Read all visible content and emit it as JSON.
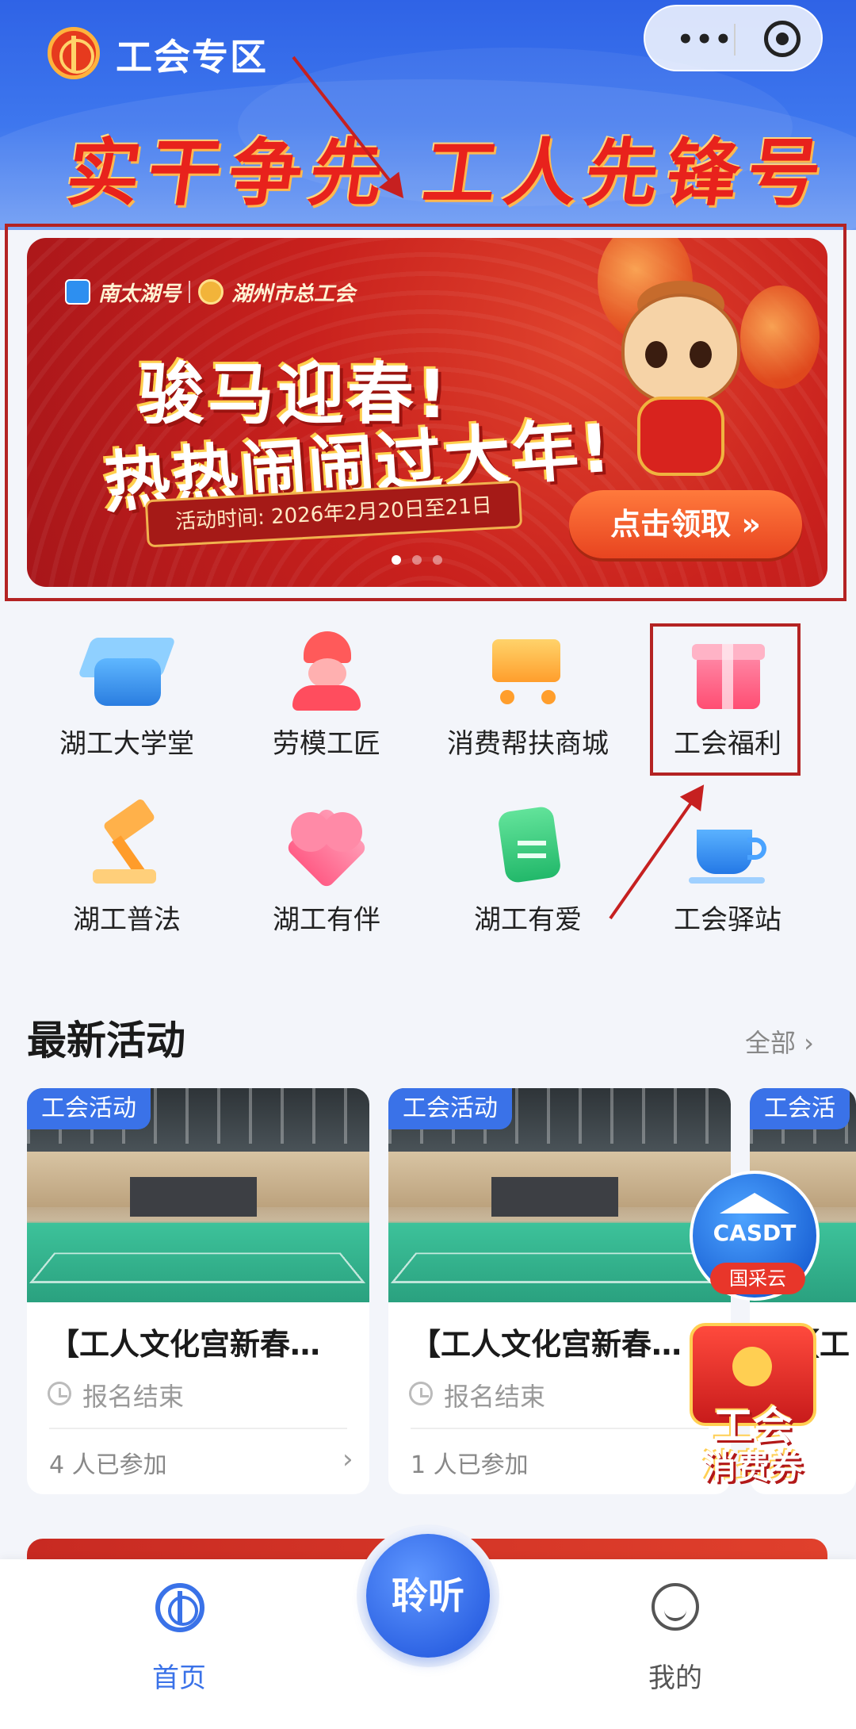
{
  "header": {
    "title": "工会专区",
    "slogan": "实干争先 工人先锋号",
    "capsule_more": "•••"
  },
  "banner": {
    "partner1": "南太湖号",
    "partner2": "湖州市总工会",
    "headline_line1": "骏马迎春!",
    "headline_line2": "热热闹闹过大年!",
    "date_text": "活动时间: 2026年2月20日至21日",
    "cta": "点击领取 »",
    "active_slide": 1,
    "slide_count": 3
  },
  "grid": [
    {
      "label": "湖工大学堂",
      "icon": "graduation-cap-icon"
    },
    {
      "label": "劳模工匠",
      "icon": "worker-icon"
    },
    {
      "label": "消费帮扶商城",
      "icon": "shopping-cart-icon"
    },
    {
      "label": "工会福利",
      "icon": "gift-icon"
    },
    {
      "label": "湖工普法",
      "icon": "gavel-icon"
    },
    {
      "label": "湖工有伴",
      "icon": "heart-icon"
    },
    {
      "label": "湖工有爱",
      "icon": "document-icon"
    },
    {
      "label": "工会驿站",
      "icon": "coffee-cup-icon"
    }
  ],
  "latest": {
    "title": "最新活动",
    "more": "全部 ›",
    "cards": [
      {
        "tag": "工会活动",
        "title": "【工人文化宫新春…",
        "status": "报名结束",
        "joined": "4 人已参加"
      },
      {
        "tag": "工会活动",
        "title": "【工人文化宫新春…",
        "status": "报名结束",
        "joined": "1 人已参加"
      },
      {
        "tag": "工会活",
        "title": "【工",
        "status": "",
        "joined": ""
      }
    ]
  },
  "floating": {
    "casdt_text": "CASDT",
    "casdt_badge": "国采云",
    "coupon_line1": "工会",
    "coupon_line2": "消费券"
  },
  "tabbar": {
    "home": "首页",
    "listen": "聆听",
    "me": "我的"
  },
  "colors": {
    "header_blue": "#3e77ee",
    "annotation_red": "#b42323",
    "accent_blue": "#3a72e8"
  }
}
